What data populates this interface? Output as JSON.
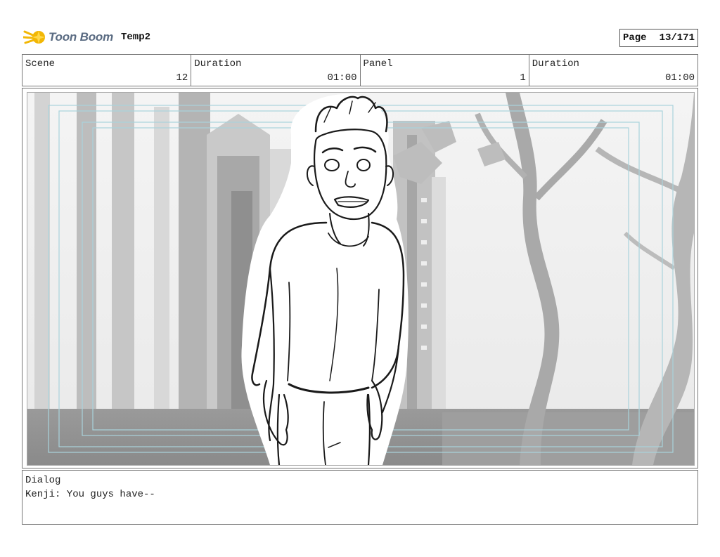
{
  "header": {
    "logo_text": "Toon Boom",
    "project_title": "Temp2",
    "page_label": "Page",
    "page_number": "13/171"
  },
  "info": {
    "scene_label": "Scene",
    "scene_value": "12",
    "scene_duration_label": "Duration",
    "scene_duration_value": "01:00",
    "panel_label": "Panel",
    "panel_value": "1",
    "panel_duration_label": "Duration",
    "panel_duration_value": "01:00"
  },
  "panel": {
    "image_icon": "storyboard-sketch-icon"
  },
  "dialog": {
    "label": "Dialog",
    "text": "Kenji: You guys have--"
  },
  "colors": {
    "logo_star": "#f2b705",
    "logo_text": "#5a6b82",
    "safe_frame": "#a9d3dc"
  }
}
